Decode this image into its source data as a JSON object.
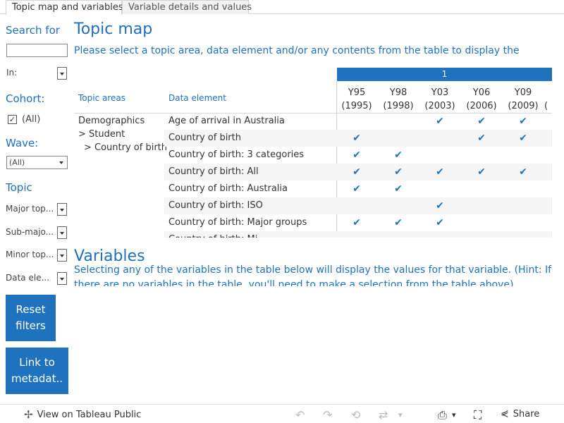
{
  "tabs": [
    {
      "label": "Topic map and variables",
      "active": true
    },
    {
      "label": "Variable details and values",
      "active": false
    }
  ],
  "sidebar": {
    "search_heading": "Search for",
    "search_value": "",
    "in_label": "In:",
    "cohort_heading": "Cohort:",
    "cohort_option": "(All)",
    "cohort_checked": true,
    "wave_heading": "Wave:",
    "wave_selected": "(All)",
    "topic_heading": "Topic",
    "filters": [
      "Major top...",
      "Sub-majo...",
      "Minor top...",
      "Data ele..."
    ],
    "reset_label_1": "Reset",
    "reset_label_2": "filters",
    "link_label_1": "Link to",
    "link_label_2": "metadat.."
  },
  "topic_map": {
    "title": "Topic map",
    "instruction": "Please select a topic area, data element and/or any contents from the table to display the",
    "cohort_band": "1",
    "col_topic_areas": "Topic areas",
    "col_data_element": "Data element",
    "waves": [
      {
        "code": "Y95",
        "year": "(1995)"
      },
      {
        "code": "Y98",
        "year": "(1998)"
      },
      {
        "code": "Y03",
        "year": "(2003)"
      },
      {
        "code": "Y06",
        "year": "(2006)"
      },
      {
        "code": "Y09",
        "year": "(2009)"
      }
    ],
    "next_wave_partial": "(",
    "topic_path": [
      "Demographics",
      "> Student",
      "> Country of birth"
    ],
    "rows": [
      {
        "element": "Age of arrival in Australia",
        "checks": [
          false,
          false,
          true,
          true,
          true
        ]
      },
      {
        "element": "Country of birth",
        "checks": [
          true,
          false,
          false,
          true,
          true
        ]
      },
      {
        "element": "Country of birth: 3 categories",
        "checks": [
          true,
          true,
          false,
          false,
          false
        ]
      },
      {
        "element": "Country of birth: All",
        "checks": [
          true,
          true,
          true,
          true,
          true
        ]
      },
      {
        "element": "Country of birth: Australia",
        "checks": [
          true,
          true,
          false,
          false,
          false
        ]
      },
      {
        "element": "Country of birth: ISO",
        "checks": [
          false,
          false,
          true,
          false,
          false
        ]
      },
      {
        "element": "Country of birth: Major groups",
        "checks": [
          true,
          true,
          true,
          false,
          false
        ]
      },
      {
        "element": "Country of birth: Mi...",
        "checks": [
          false,
          false,
          false,
          false,
          false
        ]
      }
    ],
    "check_glyph": "✔"
  },
  "variables": {
    "title": "Variables",
    "instruction_1": "Selecting any of the variables in the table below will display the values for that variable. (Hint: If",
    "instruction_2": "there are no variables in the table, you'll need to make a selection from the table above)"
  },
  "footer": {
    "view_label": "View on Tableau Public",
    "share_label": "Share",
    "icons": [
      "tableau-logo-icon",
      "undo-icon",
      "redo-icon",
      "revert-icon",
      "refresh-icon",
      "pause-icon",
      "download-icon",
      "fullscreen-icon",
      "share-icon"
    ]
  }
}
